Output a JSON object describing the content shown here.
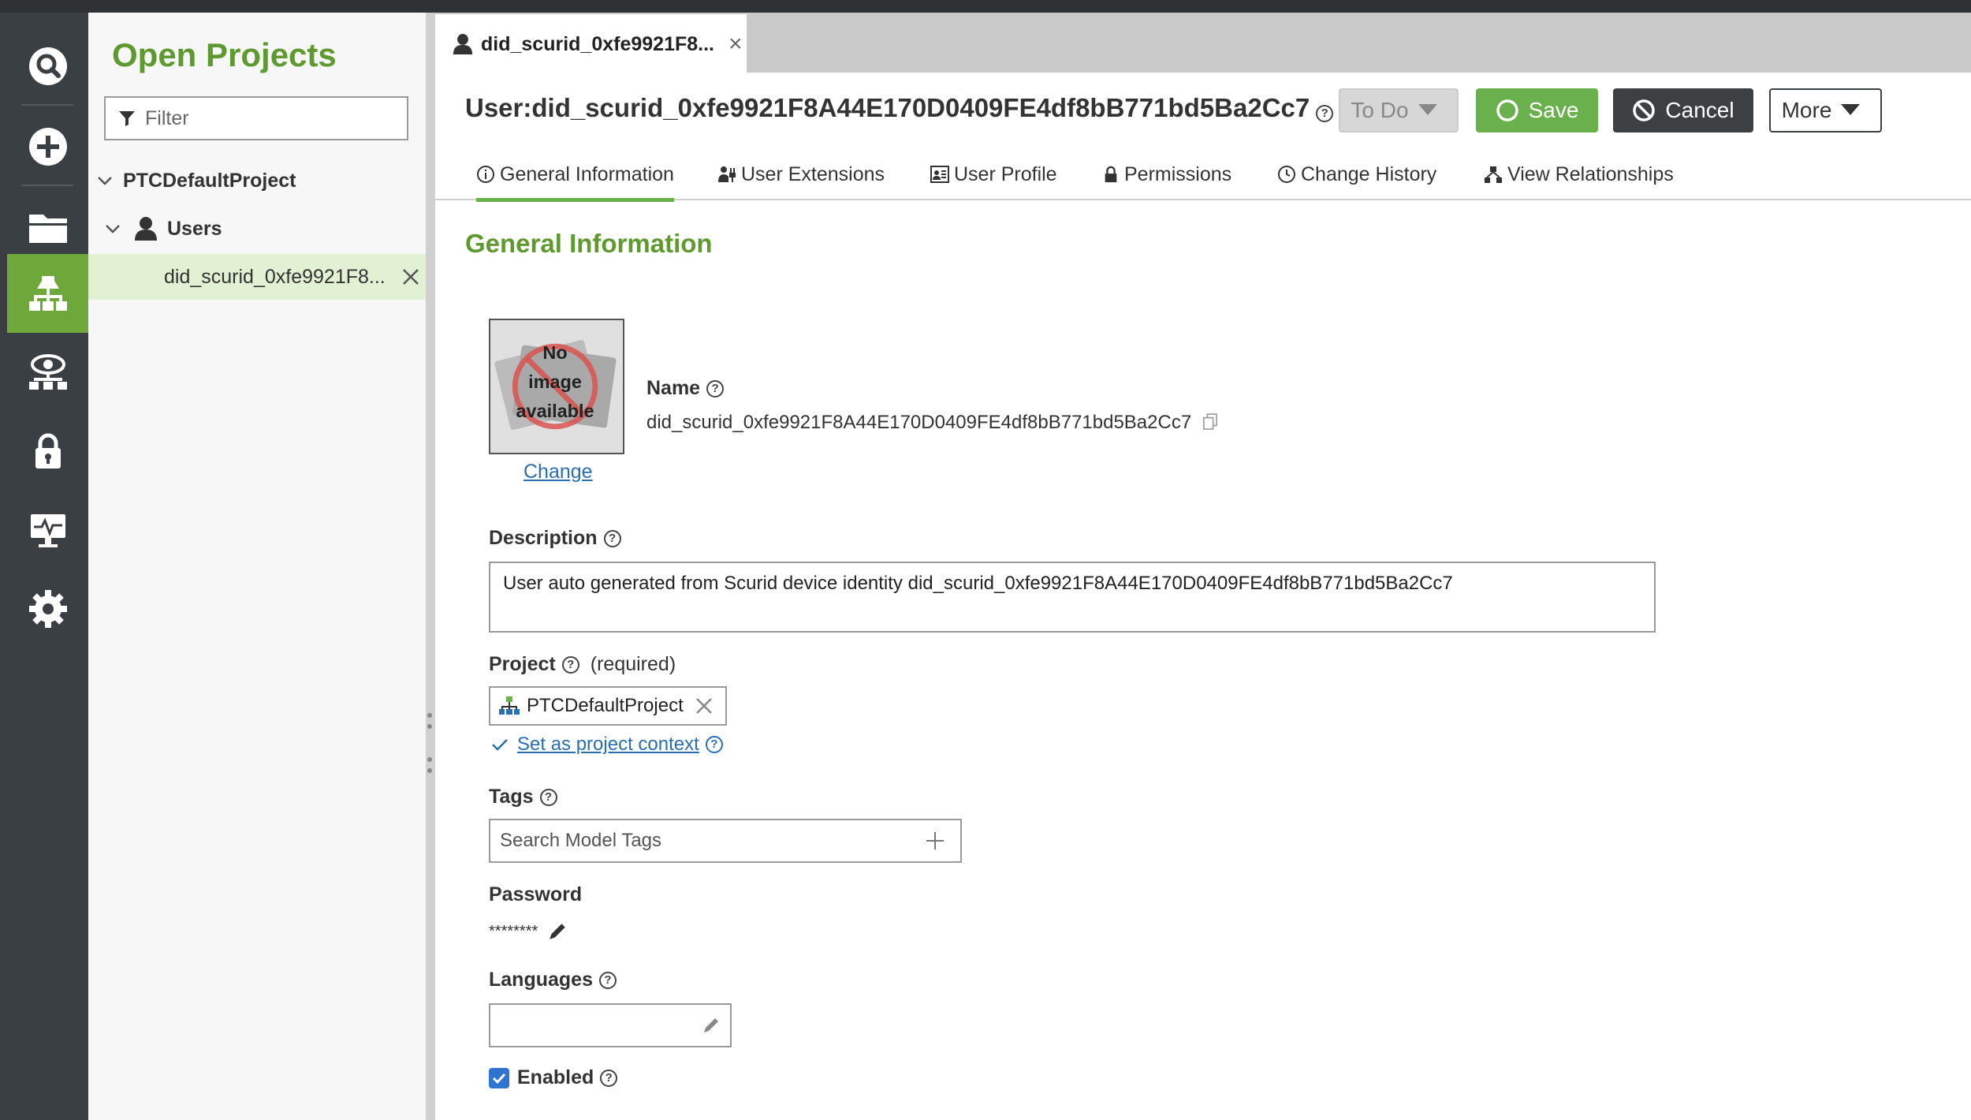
{
  "projects_panel": {
    "title": "Open Projects",
    "filter_placeholder": "Filter",
    "tree": {
      "project": "PTCDefaultProject",
      "group": "Users",
      "item": "did_scurid_0xfe9921F8..."
    }
  },
  "nav": {
    "icons": [
      "search-icon",
      "add-icon",
      "folder-icon",
      "hierarchy-icon",
      "view-icon",
      "lock-icon",
      "monitor-icon",
      "gear-icon"
    ],
    "active": "hierarchy-icon"
  },
  "editor_tab": {
    "label": "did_scurid_0xfe9921F8...",
    "close": "×"
  },
  "header": {
    "title": "User:did_scurid_0xfe9921F8A44E170D0409FE4df8bB771bd5Ba2Cc7",
    "todo_label": "To Do",
    "save_label": "Save",
    "cancel_label": "Cancel",
    "more_label": "More"
  },
  "subtabs": [
    {
      "label": "General Information",
      "icon": "info-icon"
    },
    {
      "label": "User Extensions",
      "icon": "plug-icon"
    },
    {
      "label": "User Profile",
      "icon": "profile-icon"
    },
    {
      "label": "Permissions",
      "icon": "lock-icon"
    },
    {
      "label": "Change History",
      "icon": "clock-icon"
    },
    {
      "label": "View Relationships",
      "icon": "relationships-icon"
    }
  ],
  "general": {
    "section_title": "General Information",
    "photo_text": [
      "No",
      "image",
      "available"
    ],
    "change_label": "Change",
    "name_label": "Name",
    "name_value": "did_scurid_0xfe9921F8A44E170D0409FE4df8bB771bd5Ba2Cc7",
    "description_label": "Description",
    "description_value": "User auto generated from Scurid device identity did_scurid_0xfe9921F8A44E170D0409FE4df8bB771bd5Ba2Cc7",
    "project_label": "Project",
    "project_required": "(required)",
    "project_value": "PTCDefaultProject",
    "project_context_link": "Set as project context",
    "tags_label": "Tags",
    "tags_placeholder": "Search Model Tags",
    "password_label": "Password",
    "password_value": "********",
    "languages_label": "Languages",
    "enabled_label": "Enabled",
    "enabled_checked": true
  },
  "colors": {
    "accent_green": "#6ab04c",
    "title_green": "#5f9a30",
    "nav_dark": "#3a3f43",
    "link_blue": "#2a6fb0"
  }
}
